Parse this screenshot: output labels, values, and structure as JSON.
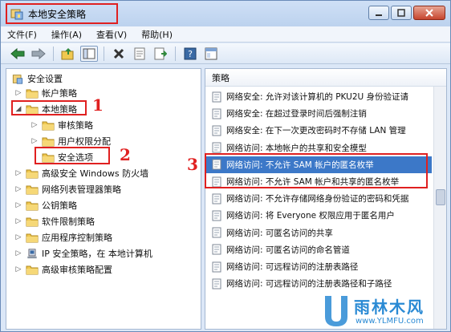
{
  "window": {
    "title": "本地安全策略"
  },
  "menu": [
    "文件(F)",
    "操作(A)",
    "查看(V)",
    "帮助(H)"
  ],
  "tree": {
    "root": "安全设置",
    "items": [
      {
        "label": "帐户策略",
        "level": 1,
        "expanded": false
      },
      {
        "label": "本地策略",
        "level": 1,
        "expanded": true
      },
      {
        "label": "审核策略",
        "level": 2,
        "expanded": false
      },
      {
        "label": "用户权限分配",
        "level": 2,
        "expanded": false
      },
      {
        "label": "安全选项",
        "level": 2,
        "expanded": false
      },
      {
        "label": "高级安全 Windows 防火墙",
        "level": 1,
        "expanded": false
      },
      {
        "label": "网络列表管理器策略",
        "level": 1,
        "expanded": false
      },
      {
        "label": "公钥策略",
        "level": 1,
        "expanded": false
      },
      {
        "label": "软件限制策略",
        "level": 1,
        "expanded": false
      },
      {
        "label": "应用程序控制策略",
        "level": 1,
        "expanded": false
      },
      {
        "label": "IP 安全策略，在 本地计算机",
        "level": 1,
        "expanded": false
      },
      {
        "label": "高级审核策略配置",
        "level": 1,
        "expanded": false
      }
    ]
  },
  "policies": {
    "header": "策略",
    "items": [
      "网络安全: 允许对该计算机的 PKU2U 身份验证请",
      "网络安全: 在超过登录时间后强制注销",
      "网络安全: 在下一次更改密码时不存储 LAN 管理",
      "网络访问: 本地帐户的共享和安全模型",
      "网络访问: 不允许 SAM 帐户的匿名枚举",
      "网络访问: 不允许 SAM 帐户和共享的匿名枚举",
      "网络访问: 不允许存储网络身份验证的密码和凭据",
      "网络访问: 将 Everyone 权限应用于匿名用户",
      "网络访问: 可匿名访问的共享",
      "网络访问: 可匿名访问的命名管道",
      "网络访问: 可远程访问的注册表路径",
      "网络访问: 可远程访问的注册表路径和子路径"
    ],
    "selected_index": 4
  },
  "annotations": {
    "a1": "1",
    "a2": "2",
    "a3": "3"
  },
  "watermark": {
    "text": "雨林木风",
    "url": "www.YLMFU.com"
  },
  "colors": {
    "highlight_red": "#e02020",
    "selection_blue": "#3c78c8",
    "folder_yellow": "#f0c850"
  }
}
